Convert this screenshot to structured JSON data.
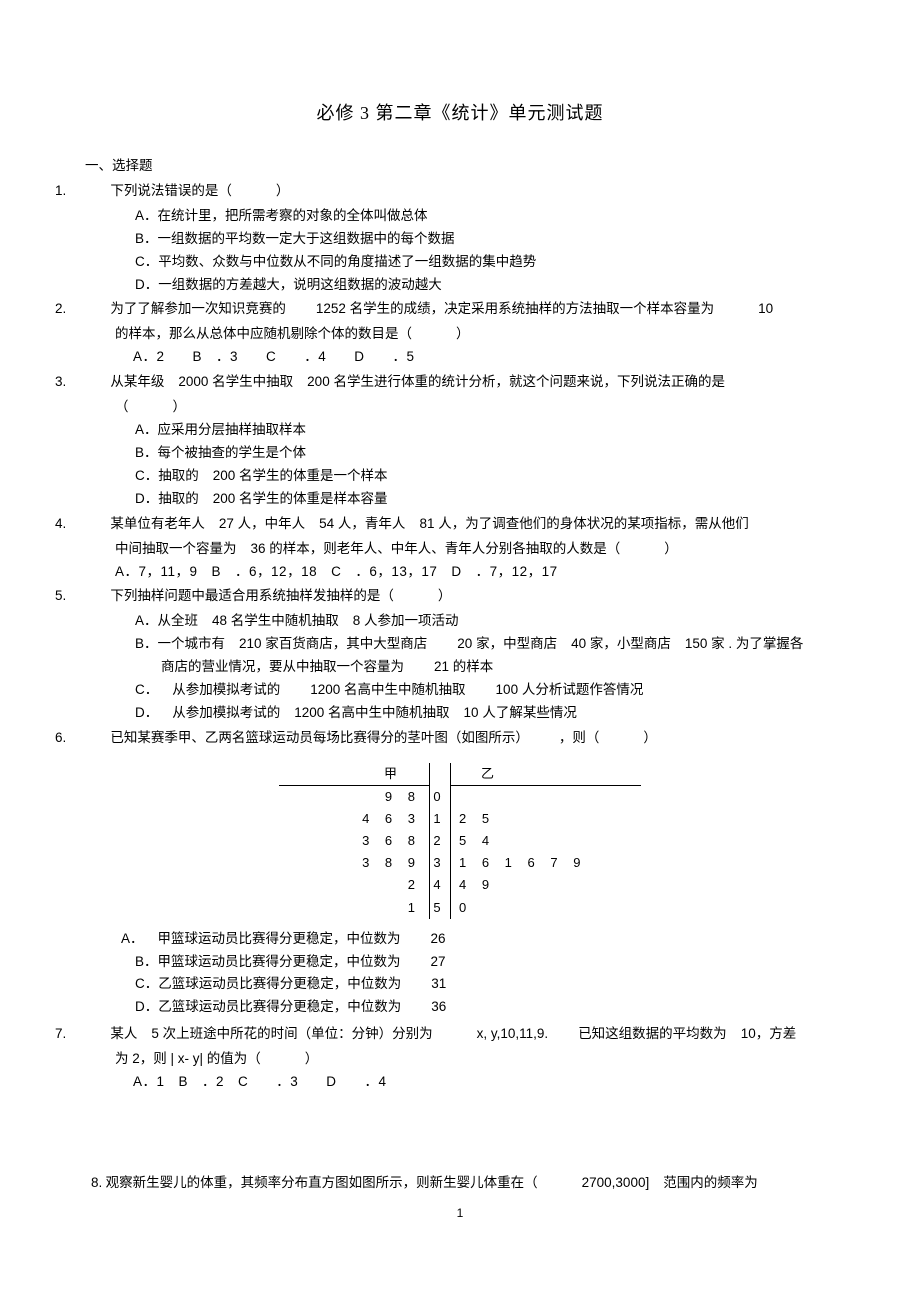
{
  "title": "必修 3 第二章《统计》单元测试题",
  "section1": "一、选择题",
  "q1": {
    "num": "1.",
    "stem": "下列说法错误的是（",
    "stem_end": "）",
    "a_label": "A．",
    "a": "在统计里，把所需考察的对象的全体叫做总体",
    "b_label": "B．",
    "b": "一组数据的平均数一定大于这组数据中的每个数据",
    "c_label": "C．",
    "c": "平均数、众数与中位数从不同的角度描述了一组数据的集中趋势",
    "d_label": "D．",
    "d": "一组数据的方差越大，说明这组数据的波动越大"
  },
  "q2": {
    "num": "2.",
    "stem_a": "为了了解参加一次知识竞赛的",
    "stem_b": "1252 名学生的成绩，决定采用系统抽样的方法抽取一个样本容量为",
    "stem_c": "10",
    "stem_d": "的样本，那么从总体中应随机剔除个体的数目是（",
    "stem_e": "）",
    "opts": "A．2　　B　．3　　C　　．4　　D　　．5"
  },
  "q3": {
    "num": "3.",
    "stem_a": "从某年级",
    "stem_b": "2000 名学生中抽取",
    "stem_c": "200 名学生进行体重的统计分析，就这个问题来说，下列说法正确的是",
    "stem_d": "（",
    "stem_e": "）",
    "a_label": "A．",
    "a": "应采用分层抽样抽取样本",
    "b_label": "B．",
    "b": "每个被抽查的学生是个体",
    "c_label": "C．",
    "c_a": "抽取的",
    "c_b": "200 名学生的体重是一个样本",
    "d_label": "D．",
    "d_a": "抽取的",
    "d_b": "200 名学生的体重是样本容量"
  },
  "q4": {
    "num": "4.",
    "stem_a": "某单位有老年人",
    "stem_b": "27 人，中年人",
    "stem_c": "54 人，青年人",
    "stem_d": "81 人，为了调查他们的身体状况的某项指标，需从他们",
    "stem_e": "中间抽取一个容量为",
    "stem_f": "36 的样本，则老年人、中年人、青年人分别各抽取的人数是（",
    "stem_g": "）",
    "opts": "A．7，11，9　B　．6，12，18　C　．6，13，17　D　．7，12，17"
  },
  "q5": {
    "num": "5.",
    "stem": "下列抽样问题中最适合用系统抽样发抽样的是（",
    "stem_end": "）",
    "a_label": "A．",
    "a_a": "从全班",
    "a_b": "48 名学生中随机抽取",
    "a_c": "8 人参加一项活动",
    "b_label": "B．",
    "b_a": "一个城市有",
    "b_b": "210 家百货商店，其中大型商店",
    "b_c": "20 家，中型商店",
    "b_d": "40 家，小型商店",
    "b_e": "150 家 . 为了掌握各",
    "b_f": "商店的营业情况，要从中抽取一个容量为",
    "b_g": "21 的样本",
    "c_label": "C．",
    "c_a": "从参加模拟考试的",
    "c_b": "1200 名高中生中随机抽取",
    "c_c": "100 人分析试题作答情况",
    "d_label": "D．",
    "d_a": "从参加模拟考试的",
    "d_b": "1200 名高中生中随机抽取",
    "d_c": "10 人了解某些情况"
  },
  "q6": {
    "num": "6.",
    "stem_a": "已知某赛季甲、乙两名篮球运动员每场比赛得分的茎叶图（如图所示）",
    "stem_b": "，则（",
    "stem_c": "）",
    "a_label": "A．",
    "a": "甲篮球运动员比赛得分更稳定，中位数为",
    "a_v": "26",
    "b_label": "B．",
    "b": "甲篮球运动员比赛得分更稳定，中位数为",
    "b_v": "27",
    "c_label": "C．",
    "c": "乙篮球运动员比赛得分更稳定，中位数为",
    "c_v": "31",
    "d_label": "D．",
    "d": "乙篮球运动员比赛得分更稳定，中位数为",
    "d_v": "36"
  },
  "stemleaf": {
    "head_left": "甲",
    "head_right": "乙",
    "rows": [
      {
        "l": "9 8",
        "m": "0",
        "r": ""
      },
      {
        "l": "4 6 3",
        "m": "1",
        "r": "2 5"
      },
      {
        "l": "3 6 8",
        "m": "2",
        "r": "5 4"
      },
      {
        "l": "3 8 9",
        "m": "3",
        "r": "1 6 1 6 7 9"
      },
      {
        "l": "2",
        "m": "4",
        "r": "4 9"
      },
      {
        "l": "1",
        "m": "5",
        "r": "0"
      }
    ]
  },
  "chart_data": {
    "type": "table",
    "title": "茎叶图",
    "left_label": "甲",
    "right_label": "乙",
    "stems": [
      0,
      1,
      2,
      3,
      4,
      5
    ],
    "left_leaves": [
      [
        9,
        8
      ],
      [
        4,
        6,
        3
      ],
      [
        3,
        6,
        8
      ],
      [
        3,
        8,
        9
      ],
      [
        2
      ],
      [
        1
      ]
    ],
    "right_leaves": [
      [],
      [
        2,
        5
      ],
      [
        5,
        4
      ],
      [
        1,
        6,
        1,
        6,
        7,
        9
      ],
      [
        4,
        9
      ],
      [
        0
      ]
    ]
  },
  "q7": {
    "num": "7.",
    "stem_a": "某人",
    "stem_b": "5 次上班途中所花的时间（单位：分钟）分别为",
    "stem_c": "x, y,10,11,9.",
    "stem_d": "已知这组数据的平均数为",
    "stem_e": "10，方差",
    "stem_f": "为 2，则 | x- y| 的值为（",
    "stem_g": "）",
    "opts": "A．1　B　．2　C　　．3　　D　　．4"
  },
  "q8": {
    "num": "8.",
    "stem_a": "观察新生婴儿的体重，其频率分布直方图如图所示，则新生婴儿体重在（",
    "stem_b": "2700,3000]",
    "stem_c": "范围内的频率为"
  },
  "page": "1"
}
